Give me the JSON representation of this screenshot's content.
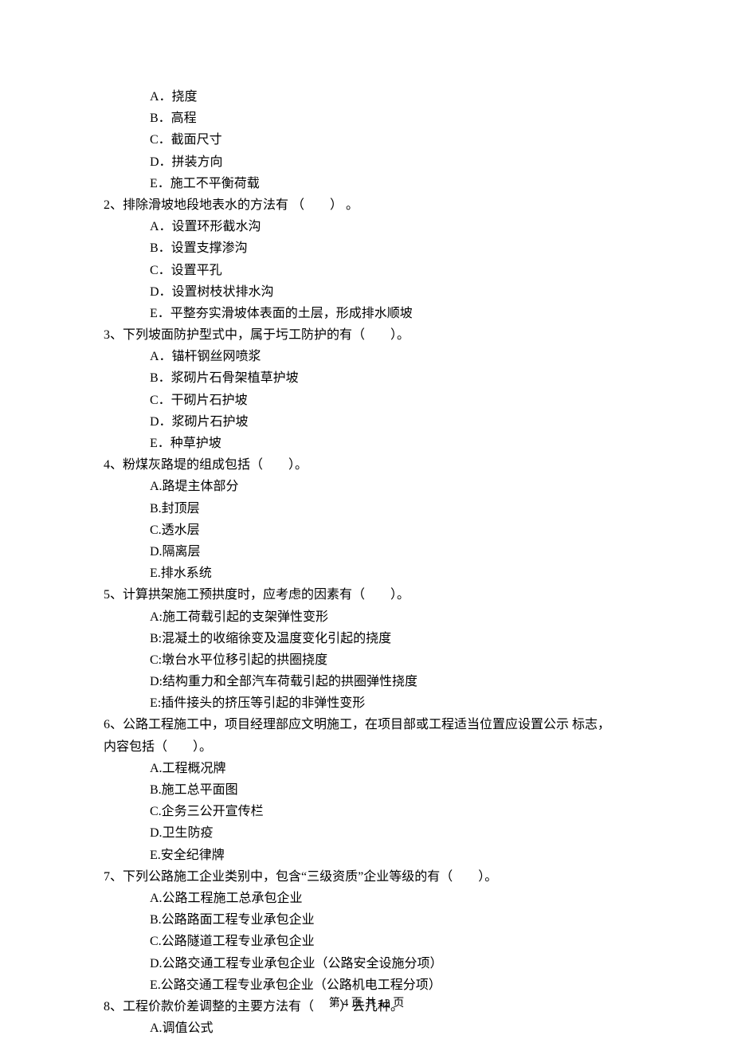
{
  "q1": {
    "options": [
      "A．挠度",
      "B．高程",
      "C．截面尺寸",
      "D．拼装方向",
      "E．施工不平衡荷载"
    ]
  },
  "q2": {
    "stem": "2、排除滑坡地段地表水的方法有 （　　） 。",
    "options": [
      "A．设置环形截水沟",
      "B．设置支撑渗沟",
      "C．设置平孔",
      "D．设置树枝状排水沟",
      "E．平整夯实滑坡体表面的土层，形成排水顺坡"
    ]
  },
  "q3": {
    "stem": "3、下列坡面防护型式中，属于圬工防护的有（　　）。",
    "options": [
      "A．锚杆钢丝网喷浆",
      "B．浆砌片石骨架植草护坡",
      "C．干砌片石护坡",
      "D．浆砌片石护坡",
      "E．种草护坡"
    ]
  },
  "q4": {
    "stem": "4、粉煤灰路堤的组成包括（　　）。",
    "options": [
      "A.路堤主体部分",
      "B.封顶层",
      "C.透水层",
      "D.隔离层",
      "E.排水系统"
    ]
  },
  "q5": {
    "stem": "5、计算拱架施工预拱度时，应考虑的因素有（　　）。",
    "options": [
      "A:施工荷载引起的支架弹性变形",
      "B:混凝土的收缩徐变及温度变化引起的挠度",
      "C:墩台水平位移引起的拱圈挠度",
      "D:结构重力和全部汽车荷载引起的拱圈弹性挠度",
      "E:插件接头的挤压等引起的非弹性变形"
    ]
  },
  "q6": {
    "stem_line1": "6、公路工程施工中，项目经理部应文明施工，在项目部或工程适当位置应设置公示 标志，",
    "stem_line2": "内容包括（　　）。",
    "options": [
      "A.工程概况牌",
      "B.施工总平面图",
      "C.企务三公开宣传栏",
      "D.卫生防疫",
      "E.安全纪律牌"
    ]
  },
  "q7": {
    "stem": "7、下列公路施工企业类别中，包含“三级资质”企业等级的有（　　）。",
    "options": [
      "A.公路工程施工总承包企业",
      "B.公路路面工程专业承包企业",
      "C.公路隧道工程专业承包企业",
      "D.公路交通工程专业承包企业（公路安全设施分项）",
      "E.公路交通工程专业承包企业（公路机电工程分项）"
    ]
  },
  "q8": {
    "stem": "8、工程价款价差调整的主要方法有（　　）去几种。",
    "options": [
      "A.调值公式"
    ]
  },
  "footer": "第 4 页 共 12 页"
}
